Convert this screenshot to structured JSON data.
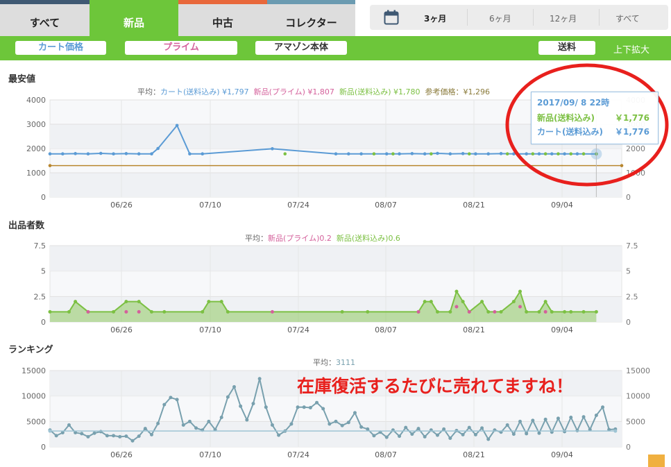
{
  "tabs": [
    {
      "label": "すべて",
      "color": "#3f5973",
      "active": false
    },
    {
      "label": "新品",
      "color": "#6dc63a",
      "active": true
    },
    {
      "label": "中古",
      "color": "#e8683b",
      "active": false
    },
    {
      "label": "コレクター",
      "color": "#6b9bb1",
      "active": false
    }
  ],
  "range": {
    "options": [
      "3ヶ月",
      "6ヶ月",
      "12ヶ月",
      "すべて"
    ],
    "selected": "3ヶ月",
    "icon": "calendar-icon"
  },
  "toolbar": {
    "cart_price": "カート価格",
    "prime": "プライム",
    "amazon": "アマゾン本体",
    "shipping": "送料",
    "zoom": "上下拡大"
  },
  "price_chart": {
    "title": "最安値",
    "avg_prefix": "平均：",
    "avg_items": [
      {
        "label": "カート(送料込み) ¥1,797",
        "color": "#5b9bd5"
      },
      {
        "label": "新品(プライム) ¥1,807",
        "color": "#d4609b"
      },
      {
        "label": "新品(送料込み) ¥1,780",
        "color": "#7cc043"
      },
      {
        "label": "参考価格：¥1,296",
        "color": "#8a7a3a"
      }
    ]
  },
  "tooltip": {
    "date": "2017/09/ 8 22時",
    "row1_label": "新品(送料込み)",
    "row1_value": "￥1,776",
    "row2_label": "カート(送料込み)",
    "row2_value": "￥1,776"
  },
  "offers_chart": {
    "title": "出品者数",
    "avg_prefix": "平均：",
    "avg_items": [
      {
        "label": "新品(プライム)0.2",
        "color": "#d4609b"
      },
      {
        "label": "新品(送料込み)0.6",
        "color": "#7cc043"
      }
    ]
  },
  "rank_chart": {
    "title": "ランキング",
    "avg_prefix": "平均：",
    "avg_value": "3111"
  },
  "annotation": "在庫復活するたびに売れてますね！",
  "chart_data": [
    {
      "type": "line",
      "title": "最安値",
      "x_ticks": [
        "06/26",
        "07/10",
        "07/24",
        "08/07",
        "08/21",
        "09/04"
      ],
      "ylim": [
        0,
        4000
      ],
      "y_ticks": [
        0,
        1000,
        2000,
        3000,
        4000
      ],
      "grid": true,
      "series": [
        {
          "name": "カート(送料込み)",
          "color": "#5b9bd5",
          "points": [
            [
              0,
              1780
            ],
            [
              2,
              1780
            ],
            [
              4,
              1790
            ],
            [
              6,
              1780
            ],
            [
              8,
              1800
            ],
            [
              10,
              1780
            ],
            [
              12,
              1790
            ],
            [
              14,
              1780
            ],
            [
              16,
              1780
            ],
            [
              17,
              2000
            ],
            [
              20,
              2950
            ],
            [
              22,
              1780
            ],
            [
              24,
              1780
            ],
            [
              35,
              1990
            ],
            [
              45,
              1780
            ],
            [
              47,
              1780
            ],
            [
              49,
              1780
            ],
            [
              53,
              1780
            ],
            [
              55,
              1780
            ],
            [
              57,
              1790
            ],
            [
              59,
              1780
            ],
            [
              61,
              1800
            ],
            [
              63,
              1780
            ],
            [
              65,
              1790
            ],
            [
              67,
              1780
            ],
            [
              69,
              1780
            ],
            [
              71,
              1790
            ],
            [
              73,
              1780
            ],
            [
              75,
              1780
            ],
            [
              77,
              1780
            ],
            [
              79,
              1780
            ],
            [
              81,
              1780
            ],
            [
              83,
              1780
            ],
            [
              86,
              1776
            ]
          ]
        },
        {
          "name": "新品(送料込み)",
          "color": "#7cc043",
          "points": [
            [
              37,
              1780
            ],
            [
              51,
              1780
            ],
            [
              54,
              1780
            ],
            [
              60,
              1780
            ],
            [
              66,
              1780
            ],
            [
              72,
              1780
            ],
            [
              76,
              1780
            ],
            [
              78,
              1780
            ],
            [
              80,
              1780
            ],
            [
              82,
              1780
            ],
            [
              84,
              1780
            ],
            [
              86,
              1776
            ]
          ]
        },
        {
          "name": "参考価格",
          "color": "#b8862e",
          "points": [
            [
              0,
              1296
            ],
            [
              90,
              1296
            ]
          ]
        }
      ]
    },
    {
      "type": "area",
      "title": "出品者数",
      "x_ticks": [
        "06/26",
        "07/10",
        "07/24",
        "08/07",
        "08/21",
        "09/04"
      ],
      "ylim": [
        0,
        7.5
      ],
      "y_ticks": [
        0,
        2.5,
        5,
        7.5
      ],
      "grid": true,
      "series": [
        {
          "name": "新品(送料込み)",
          "color": "#7cc043",
          "points": [
            [
              0,
              1
            ],
            [
              3,
              1
            ],
            [
              4,
              2
            ],
            [
              6,
              1
            ],
            [
              10,
              1
            ],
            [
              12,
              2
            ],
            [
              14,
              2
            ],
            [
              16,
              1
            ],
            [
              18,
              1
            ],
            [
              24,
              1
            ],
            [
              25,
              2
            ],
            [
              27,
              2
            ],
            [
              28,
              1
            ],
            [
              46,
              1
            ],
            [
              50,
              1
            ],
            [
              58,
              1
            ],
            [
              59,
              2
            ],
            [
              60,
              2
            ],
            [
              61,
              1
            ],
            [
              63,
              1
            ],
            [
              64,
              3
            ],
            [
              65,
              2
            ],
            [
              66,
              1
            ],
            [
              68,
              2
            ],
            [
              69,
              1
            ],
            [
              71,
              1
            ],
            [
              73,
              2
            ],
            [
              74,
              3
            ],
            [
              75,
              1
            ],
            [
              77,
              1
            ],
            [
              78,
              2
            ],
            [
              79,
              1
            ],
            [
              81,
              1
            ],
            [
              82,
              1
            ],
            [
              84,
              1
            ],
            [
              86,
              1
            ]
          ]
        },
        {
          "name": "新品(プライム)",
          "color": "#d4609b",
          "points": [
            [
              6,
              1
            ],
            [
              12,
              1
            ],
            [
              14,
              1
            ],
            [
              35,
              1
            ],
            [
              58,
              1
            ],
            [
              64,
              1.5
            ],
            [
              66,
              1
            ],
            [
              70,
              1
            ],
            [
              74,
              1.5
            ],
            [
              78,
              1
            ]
          ]
        }
      ]
    },
    {
      "type": "line",
      "title": "ランキング",
      "x_ticks": [
        "06/26",
        "07/10",
        "07/24",
        "08/07",
        "08/21",
        "09/04"
      ],
      "ylim": [
        0,
        15000
      ],
      "y_ticks": [
        0,
        5000,
        10000,
        15000
      ],
      "grid": true,
      "average": 3111,
      "series": [
        {
          "name": "ランキング",
          "color": "#78a0ae",
          "points": [
            [
              0,
              3300
            ],
            [
              1,
              2200
            ],
            [
              2,
              2800
            ],
            [
              3,
              4300
            ],
            [
              4,
              2800
            ],
            [
              5,
              2600
            ],
            [
              6,
              2000
            ],
            [
              7,
              2700
            ],
            [
              8,
              3000
            ],
            [
              9,
              2200
            ],
            [
              10,
              2200
            ],
            [
              11,
              2000
            ],
            [
              12,
              2100
            ],
            [
              13,
              1200
            ],
            [
              14,
              2100
            ],
            [
              15,
              3600
            ],
            [
              16,
              2400
            ],
            [
              17,
              4600
            ],
            [
              18,
              8300
            ],
            [
              19,
              9700
            ],
            [
              20,
              9300
            ],
            [
              21,
              4300
            ],
            [
              22,
              5000
            ],
            [
              23,
              3700
            ],
            [
              24,
              3300
            ],
            [
              25,
              5000
            ],
            [
              26,
              3400
            ],
            [
              27,
              5800
            ],
            [
              28,
              9800
            ],
            [
              29,
              11800
            ],
            [
              30,
              8000
            ],
            [
              31,
              5300
            ],
            [
              32,
              8500
            ],
            [
              33,
              13400
            ],
            [
              34,
              7800
            ],
            [
              35,
              4300
            ],
            [
              36,
              2300
            ],
            [
              37,
              3100
            ],
            [
              38,
              4500
            ],
            [
              39,
              7800
            ],
            [
              40,
              7800
            ],
            [
              41,
              7700
            ],
            [
              42,
              8700
            ],
            [
              43,
              7500
            ],
            [
              44,
              4500
            ],
            [
              45,
              5000
            ],
            [
              46,
              4200
            ],
            [
              47,
              4800
            ],
            [
              48,
              6700
            ],
            [
              49,
              3900
            ],
            [
              50,
              3500
            ],
            [
              51,
              2200
            ],
            [
              52,
              2900
            ],
            [
              53,
              1900
            ],
            [
              54,
              3300
            ],
            [
              55,
              2100
            ],
            [
              56,
              3800
            ],
            [
              57,
              2500
            ],
            [
              58,
              3600
            ],
            [
              59,
              2000
            ],
            [
              60,
              3300
            ],
            [
              61,
              2300
            ],
            [
              62,
              3500
            ],
            [
              63,
              1700
            ],
            [
              64,
              3200
            ],
            [
              65,
              2400
            ],
            [
              66,
              3800
            ],
            [
              67,
              2400
            ],
            [
              68,
              3700
            ],
            [
              69,
              1500
            ],
            [
              70,
              3300
            ],
            [
              71,
              2900
            ],
            [
              72,
              4300
            ],
            [
              73,
              2500
            ],
            [
              74,
              5000
            ],
            [
              75,
              2600
            ],
            [
              76,
              5200
            ],
            [
              77,
              2700
            ],
            [
              78,
              5400
            ],
            [
              79,
              2900
            ],
            [
              80,
              5600
            ],
            [
              81,
              3000
            ],
            [
              82,
              5800
            ],
            [
              83,
              3200
            ],
            [
              84,
              5900
            ],
            [
              85,
              3400
            ],
            [
              86,
              6200
            ],
            [
              87,
              7800
            ],
            [
              88,
              3400
            ],
            [
              89,
              3500
            ]
          ]
        },
        {
          "name": "平均",
          "color": "#9ec4d4",
          "points": [
            [
              0,
              3111
            ],
            [
              89,
              3111
            ]
          ]
        }
      ]
    }
  ]
}
